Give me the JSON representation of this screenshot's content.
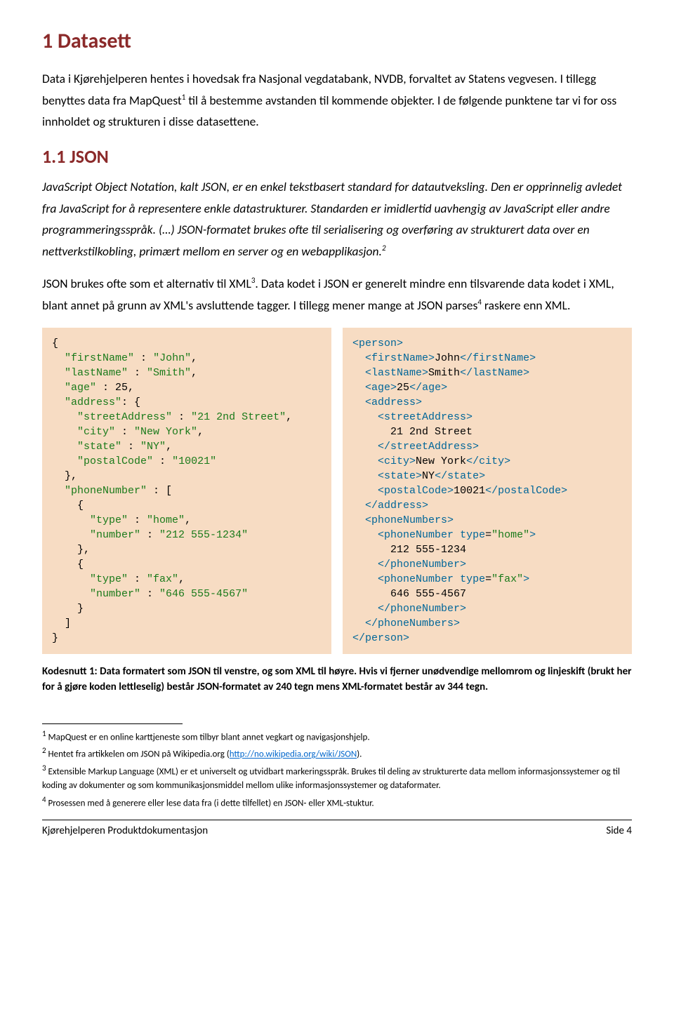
{
  "headings": {
    "h1": "1   Datasett",
    "h2": "1.1   JSON"
  },
  "paragraphs": {
    "p1": "Data i Kjørehjelperen hentes i hovedsak fra Nasjonal vegdatabank, NVDB, forvaltet av Statens vegvesen. I tillegg benyttes data fra MapQuest",
    "p1b": " til å bestemme avstanden til kommende objekter. I de følgende punktene tar vi for oss innholdet og strukturen i disse datasettene.",
    "p2": "JavaScript Object Notation, kalt JSON, er en enkel tekstbasert standard for datautveksling. Den er opprinnelig avledet fra JavaScript for å representere enkle datastrukturer. Standarden er imidlertid uavhengig av JavaScript eller andre programmeringsspråk. (…) JSON-formatet brukes ofte til serialisering og overføring av strukturert data over en nettverkstilkobling, primært mellom en server og en webapplikasjon.",
    "p3a": "JSON brukes ofte som et alternativ til XML",
    "p3b": ". Data kodet i JSON er generelt mindre enn tilsvarende data kodet i XML, blant annet på grunn av XML's avsluttende tagger. I tillegg mener mange at JSON parses",
    "p3c": " raskere enn XML."
  },
  "code": {
    "json": "{\n  \"firstName\" : \"John\",\n  \"lastName\" : \"Smith\",\n  \"age\" : 25,\n  \"address\": {\n    \"streetAddress\" : \"21 2nd Street\",\n    \"city\" : \"New York\",\n    \"state\" : \"NY\",\n    \"postalCode\" : \"10021\"\n  },\n  \"phoneNumber\" : [\n    {\n      \"type\" : \"home\",\n      \"number\" : \"212 555-1234\"\n    },\n    {\n      \"type\" : \"fax\",\n      \"number\" : \"646 555-4567\"\n    }\n  ]\n}",
    "xml": "<person>\n  <firstName>John</firstName>\n  <lastName>Smith</lastName>\n  <age>25</age>\n  <address>\n    <streetAddress>\n      21 2nd Street\n    </streetAddress>\n    <city>New York</city>\n    <state>NY</state>\n    <postalCode>10021</postalCode>\n  </address>\n  <phoneNumbers>\n    <phoneNumber type=\"home\">\n      212 555-1234\n    </phoneNumber>\n    <phoneNumber type=\"fax\">\n      646 555-4567\n    </phoneNumber>\n  </phoneNumbers>\n</person>"
  },
  "caption": "Kodesnutt 1: Data formatert som JSON til venstre, og som XML til høyre. Hvis vi fjerner unødvendige mellomrom og linjeskift (brukt her for å gjøre koden lettleselig) består JSON-formatet av 240 tegn mens XML-formatet består av 344 tegn.",
  "footnotes": {
    "f1": " MapQuest er en online karttjeneste som tilbyr blant annet vegkart og navigasjonshjelp.",
    "f2a": " Hentet fra artikkelen om JSON på Wikipedia.org (",
    "f2link": "http://no.wikipedia.org/wiki/JSON",
    "f2b": ").",
    "f3": " Extensible Markup Language (XML) er et universelt og utvidbart markeringsspråk. Brukes til deling av strukturerte data mellom informasjonssystemer og til koding av dokumenter og som kommunikasjonsmiddel mellom ulike informasjonssystemer og dataformater.",
    "f4": " Prosessen med å generere eller lese data fra (i dette tilfellet) en JSON- eller XML-stuktur."
  },
  "footer": {
    "left": "Kjørehjelperen Produktdokumentasjon",
    "right": "Side 4"
  }
}
